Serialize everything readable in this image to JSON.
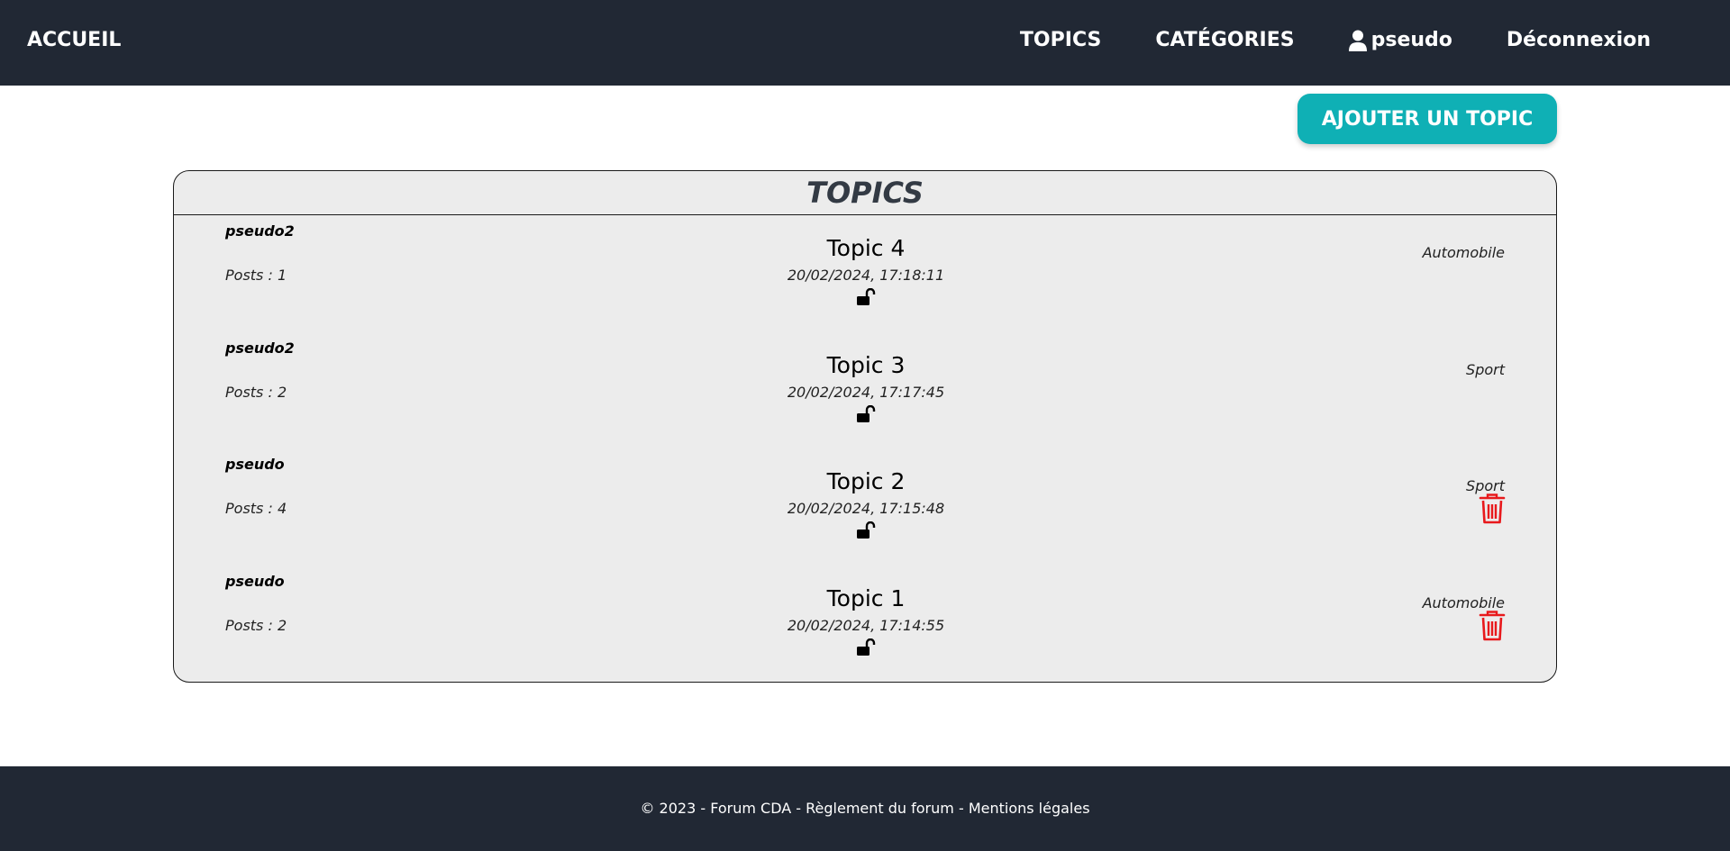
{
  "nav": {
    "brand": "ACCUEIL",
    "links": [
      {
        "label": "TOPICS"
      },
      {
        "label": "CATÉGORIES"
      },
      {
        "label": "pseudo",
        "icon": "user-icon"
      },
      {
        "label": "Déconnexion"
      }
    ]
  },
  "add_button": {
    "label": "AJOUTER UN TOPIC",
    "color": "#0fb0b5"
  },
  "topics": {
    "header": "TOPICS",
    "rows": [
      {
        "author": "pseudo2",
        "posts": "Posts : 1",
        "title": "Topic 4",
        "date": "20/02/2024, 17:18:11",
        "category": "Automobile",
        "locked": false,
        "can_delete": false
      },
      {
        "author": "pseudo2",
        "posts": "Posts : 2",
        "title": "Topic 3",
        "date": "20/02/2024, 17:17:45",
        "category": "Sport",
        "locked": false,
        "can_delete": false
      },
      {
        "author": "pseudo",
        "posts": "Posts : 4",
        "title": "Topic 2",
        "date": "20/02/2024, 17:15:48",
        "category": "Sport",
        "locked": false,
        "can_delete": true
      },
      {
        "author": "pseudo",
        "posts": "Posts : 2",
        "title": "Topic 1",
        "date": "20/02/2024, 17:14:55",
        "category": "Automobile",
        "locked": false,
        "can_delete": true
      }
    ]
  },
  "footer": {
    "copyright": "© 2023 - Forum CDA - ",
    "rules": "Règlement du forum",
    "separator": " - ",
    "legal": "Mentions légales"
  },
  "colors": {
    "navbar_bg": "#212834",
    "card_bg": "#ececec",
    "delete_icon": "#e8191c"
  }
}
